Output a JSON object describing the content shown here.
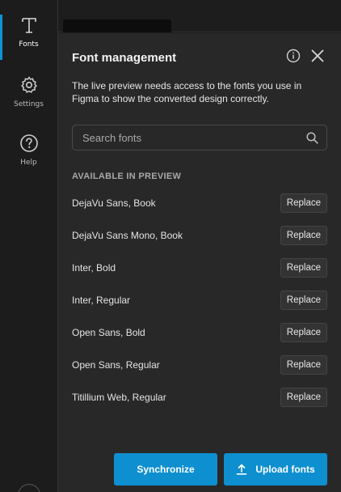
{
  "rail": {
    "items": [
      {
        "label": "Fonts",
        "icon": "type-icon",
        "active": true
      },
      {
        "label": "Settings",
        "icon": "gear-icon",
        "active": false
      },
      {
        "label": "Help",
        "icon": "question-circle-icon",
        "active": false
      }
    ]
  },
  "panel": {
    "title": "Font management",
    "description": "The live preview needs access to the fonts you use in Figma to show the converted design correctly.",
    "search_placeholder": "Search fonts",
    "section_heading": "AVAILABLE IN PREVIEW",
    "replace_label": "Replace",
    "fonts": [
      "DejaVu Sans, Book",
      "DejaVu Sans Mono, Book",
      "Inter, Bold",
      "Inter, Regular",
      "Open Sans, Bold",
      "Open Sans, Regular",
      "Titillium Web, Regular"
    ],
    "synchronize_label": "Synchronize",
    "upload_label": "Upload fonts"
  },
  "colors": {
    "accent": "#0e8fcf",
    "panel_bg": "#282828",
    "rail_bg": "#1c1c1c"
  }
}
